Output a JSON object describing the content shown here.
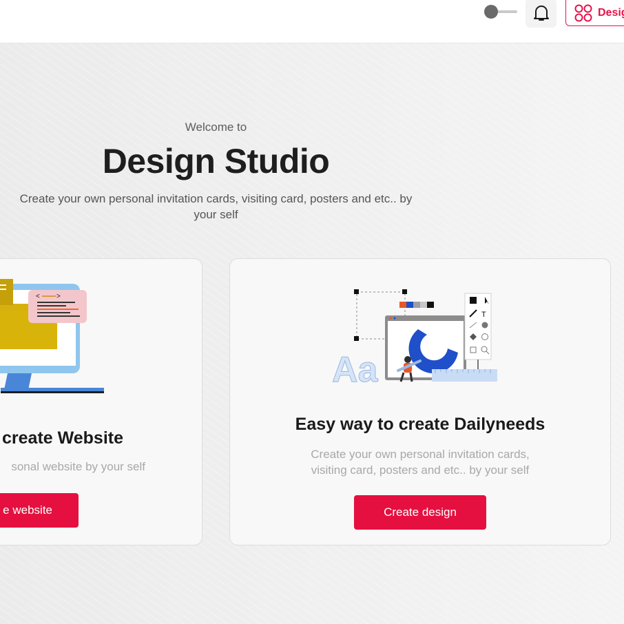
{
  "header": {
    "theme_toggle": "theme toggle",
    "design_button_label": "Design",
    "icons": {
      "bell": "bell-icon",
      "design": "grid-circles-icon"
    },
    "accent_color": "#e5103f"
  },
  "hero": {
    "welcome": "Welcome to",
    "title": "Design Studio",
    "subtitle": "Create your own personal invitation cards, visiting card, posters and etc.. by your self"
  },
  "cards": [
    {
      "title": "create Website",
      "description": "sonal website by your self",
      "button_label": "e website"
    },
    {
      "title": "Easy way to create Dailyneeds",
      "description": "Create your own personal invitation cards, visiting card, posters and etc.. by your self",
      "button_label": "Create design",
      "illustration_text": "Aa"
    }
  ]
}
